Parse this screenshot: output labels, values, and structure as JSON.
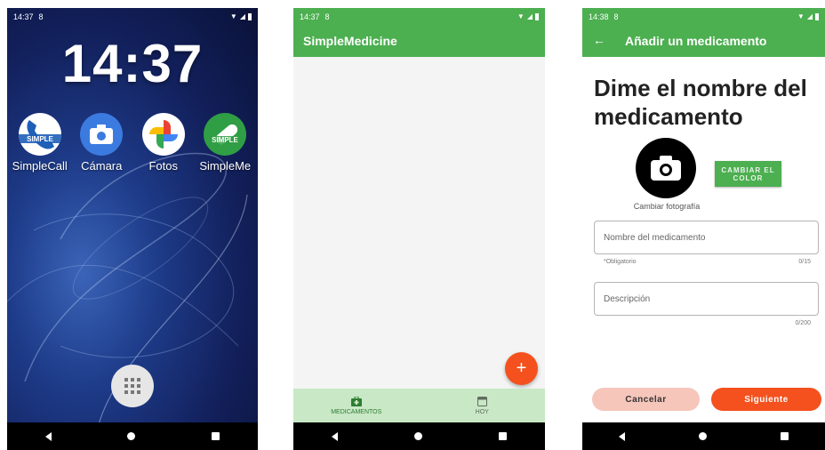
{
  "colors": {
    "primary_green": "#4caf50",
    "accent_orange": "#f4511e",
    "cancel_pink": "#f6c6bb",
    "bottom_nav_green": "#c9e8c6"
  },
  "home_screen": {
    "status_time": "14:37",
    "status_icon": "8",
    "clock": "14:37",
    "apps": [
      {
        "label": "SimpleCall",
        "icon": "simplecall-icon",
        "badge": "SIMPLE"
      },
      {
        "label": "Cámara",
        "icon": "camera-icon"
      },
      {
        "label": "Fotos",
        "icon": "photos-pinwheel-icon"
      },
      {
        "label": "SimpleMe",
        "icon": "simplemedicine-pill-icon",
        "badge": "SIMPLE"
      }
    ],
    "launcher_icon": "app-drawer-grid-icon"
  },
  "list_screen": {
    "status_time": "14:37",
    "status_icon": "8",
    "title": "SimpleMedicine",
    "fab_label": "+",
    "bottom_nav": [
      {
        "label": "MEDICAMENTOS",
        "icon": "medical-kit-icon",
        "active": true
      },
      {
        "label": "HOY",
        "icon": "calendar-icon",
        "active": false
      }
    ]
  },
  "add_screen": {
    "status_time": "14:38",
    "status_icon": "8",
    "title": "Añadir un medicamento",
    "headline": "Dime el nombre del medicamento",
    "photo_label": "Cambiar fotografía",
    "color_button": "CAMBIAR EL COLOR",
    "name_field": {
      "placeholder": "Nombre del medicamento",
      "helper": "*Obligatorio",
      "counter": "0/15"
    },
    "description_field": {
      "placeholder": "Descripción",
      "counter": "0/200"
    },
    "cancel_label": "Cancelar",
    "next_label": "Siguiente"
  }
}
